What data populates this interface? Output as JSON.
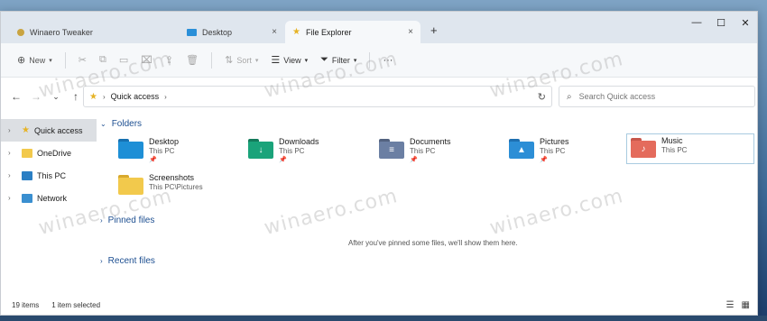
{
  "tabs": [
    {
      "label": "Winaero Tweaker",
      "active": false
    },
    {
      "label": "Desktop",
      "active": false
    },
    {
      "label": "File Explorer",
      "active": true
    }
  ],
  "tab_close_glyph": "×",
  "new_tab_glyph": "+",
  "window_controls": {
    "minimize": "—",
    "maximize": "☐",
    "close": "✕"
  },
  "toolbar": {
    "new_label": "New",
    "sort_label": "Sort",
    "view_label": "View",
    "filter_label": "Filter",
    "more_label": "···"
  },
  "address": {
    "path": [
      "Quick access"
    ]
  },
  "search": {
    "placeholder": "Search Quick access"
  },
  "sidebar": {
    "items": [
      {
        "label": "Quick access",
        "selected": true
      },
      {
        "label": "OneDrive",
        "selected": false
      },
      {
        "label": "This PC",
        "selected": false
      },
      {
        "label": "Network",
        "selected": false
      }
    ]
  },
  "sections": {
    "folders": "Folders",
    "pinned": "Pinned files",
    "recent": "Recent files"
  },
  "folders": [
    {
      "name": "Desktop",
      "location": "This PC",
      "pinned": true,
      "color": "#1e8fd6"
    },
    {
      "name": "Downloads",
      "location": "This PC",
      "pinned": true,
      "color": "#1aa37a"
    },
    {
      "name": "Documents",
      "location": "This PC",
      "pinned": true,
      "color": "#6b7fa3"
    },
    {
      "name": "Pictures",
      "location": "This PC",
      "pinned": true,
      "color": "#2c8ed6"
    },
    {
      "name": "Music",
      "location": "This PC",
      "pinned": false,
      "color": "#e46b5c"
    },
    {
      "name": "Screenshots",
      "location": "This PC\\Pictures",
      "pinned": false,
      "color": "#f2c94c"
    }
  ],
  "pinned_empty_message": "After you've pinned some files, we'll show them here.",
  "status": {
    "items_count": "19 items",
    "selection": "1 item selected"
  },
  "watermark": "winaero.com"
}
